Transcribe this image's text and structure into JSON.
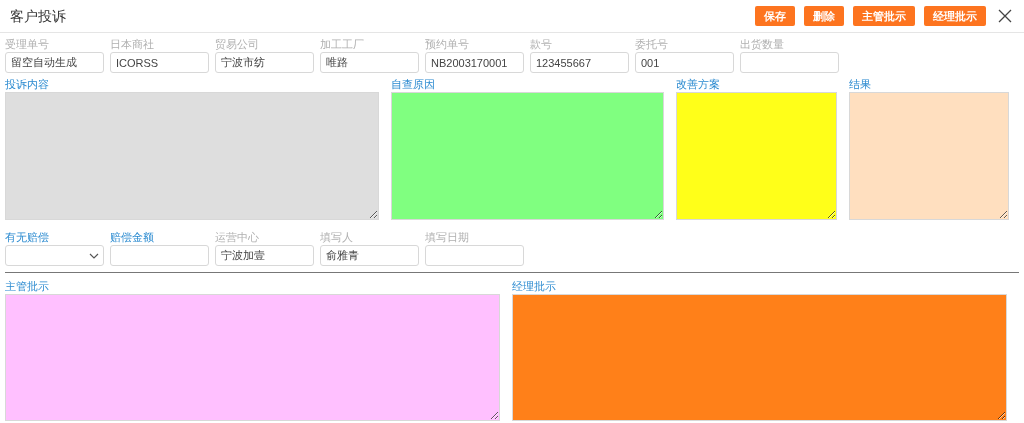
{
  "window": {
    "title": "客户投诉"
  },
  "buttons": [
    {
      "label": "保存"
    },
    {
      "label": "删除"
    },
    {
      "label": "主管批示"
    },
    {
      "label": "经理批示"
    }
  ],
  "fields_top": [
    {
      "kind": "text",
      "label": "受理单号",
      "value": "留空自动生成",
      "disabled": true
    },
    {
      "kind": "text",
      "label": "日本商社",
      "value": "ICORSS",
      "disabled": true
    },
    {
      "kind": "text",
      "label": "贸易公司",
      "value": "宁波市纺",
      "disabled": true
    },
    {
      "kind": "text",
      "label": "加工工厂",
      "value": "唯路",
      "disabled": true
    },
    {
      "kind": "text",
      "label": "预约单号",
      "value": "NB2003170001",
      "disabled": true
    },
    {
      "kind": "text",
      "label": "款号",
      "value": "123455667",
      "disabled": true
    },
    {
      "kind": "text",
      "label": "委托号",
      "value": "001",
      "disabled": true
    },
    {
      "kind": "text",
      "label": "出货数量",
      "disabled": true
    }
  ],
  "notes_top": [
    {
      "label": "投诉内容",
      "color": "#dedede"
    },
    {
      "label": "自查原因",
      "color": "#80ff80"
    },
    {
      "label": "改善方案",
      "color": "#ffff19"
    },
    {
      "label": "结果",
      "color": "#ffdfbf"
    }
  ],
  "fields_bottom": [
    {
      "kind": "select",
      "label": "有无赔偿",
      "disabled": false
    },
    {
      "kind": "text",
      "label": "赔偿金额",
      "disabled": false
    },
    {
      "kind": "text",
      "label": "运营中心",
      "value": "宁波加壹",
      "disabled": true
    },
    {
      "kind": "text",
      "label": "填写人",
      "value": "俞雅青",
      "disabled": true
    },
    {
      "kind": "text",
      "label": "填写日期",
      "disabled": true
    }
  ],
  "approvals": [
    {
      "label": "主管批示",
      "color": "#ffc0ff"
    },
    {
      "label": "经理批示",
      "color": "#ff8019"
    }
  ]
}
